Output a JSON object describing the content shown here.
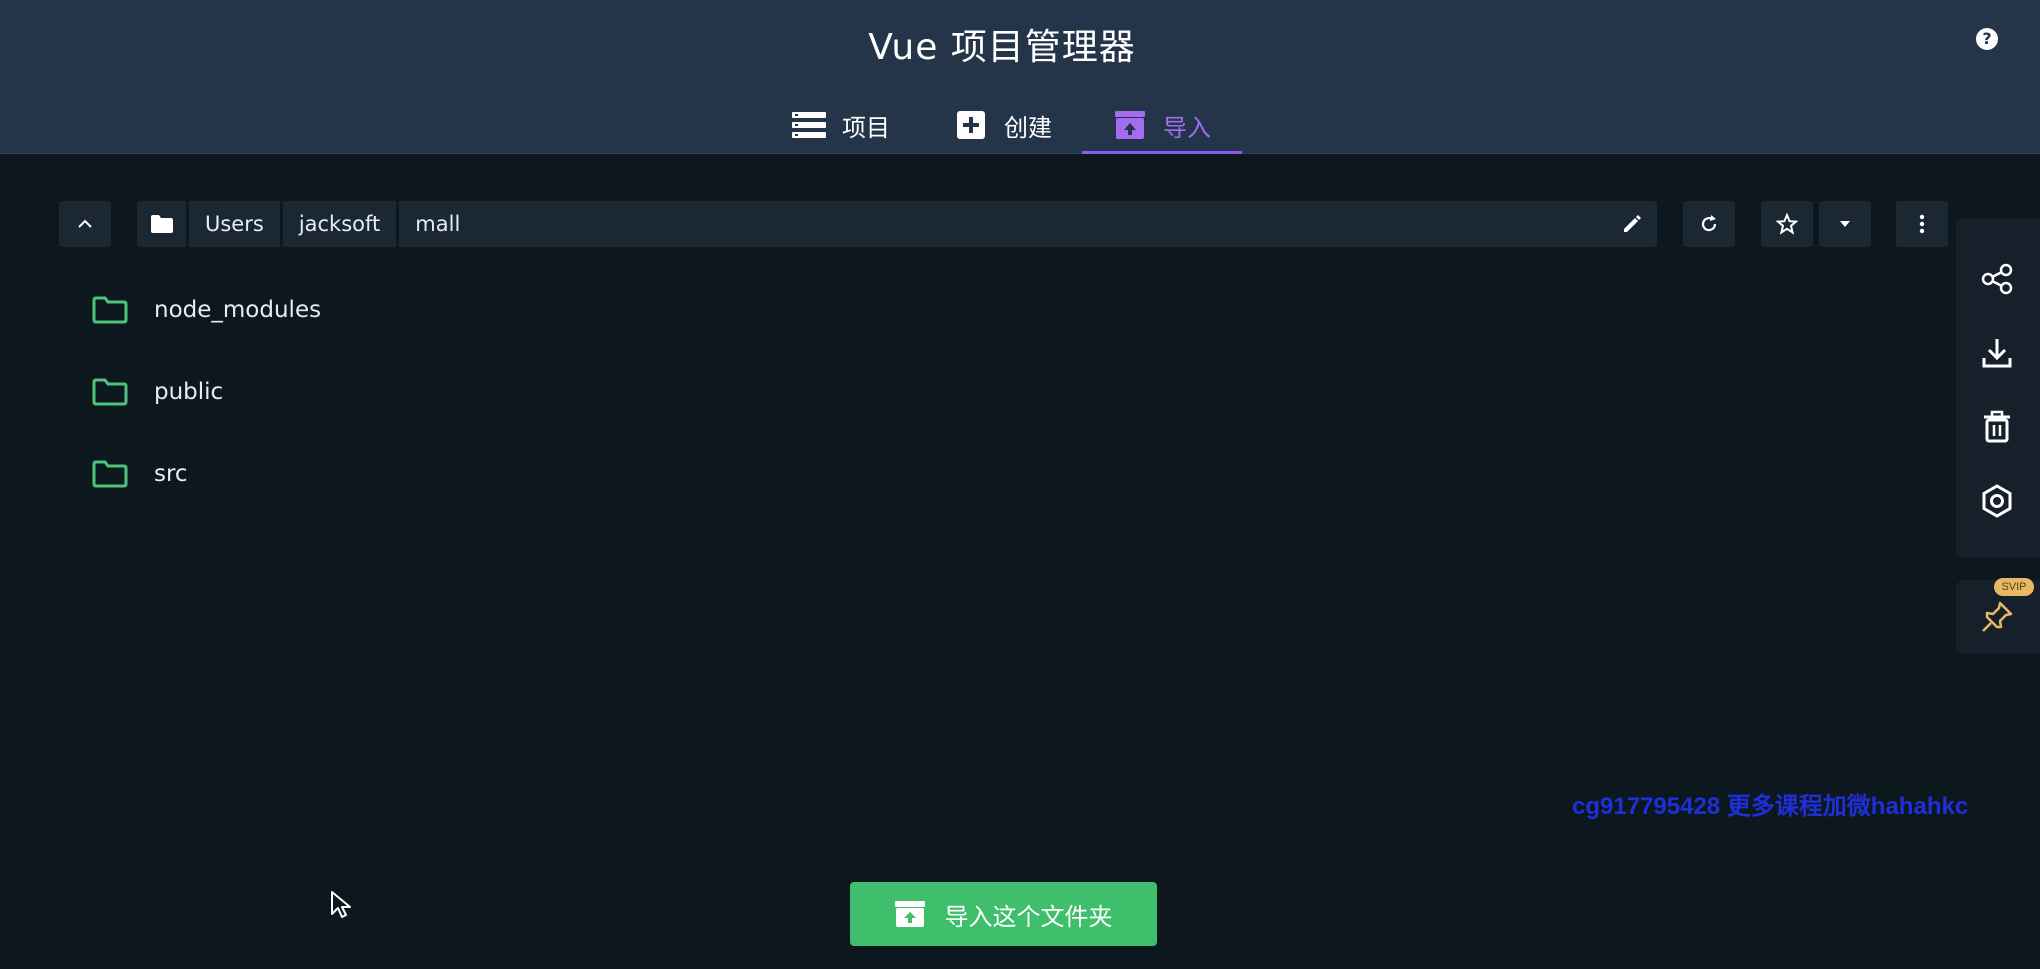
{
  "header": {
    "title": "Vue 项目管理器",
    "help_icon": "help-icon",
    "help_glyph": "?"
  },
  "tabs": [
    {
      "label": "项目",
      "icon": "list-icon"
    },
    {
      "label": "创建",
      "icon": "plus-square-icon"
    },
    {
      "label": "导入",
      "icon": "import-box-icon",
      "active": true
    }
  ],
  "toolbar": {
    "path_segments": [
      "Users",
      "jacksoft",
      "mall"
    ]
  },
  "folders": [
    {
      "name": "node_modules"
    },
    {
      "name": "public"
    },
    {
      "name": "src"
    }
  ],
  "side_panel": {
    "icons": [
      "share-icon",
      "download-icon",
      "trash-icon",
      "settings-icon"
    ],
    "pin_badge": "SVIP"
  },
  "watermark": "cg917795428 更多课程加微hahahkc",
  "import_button": {
    "label": "导入这个文件夹"
  },
  "colors": {
    "header_bg": "#24354a",
    "body_bg": "#0d171e",
    "accent_purple": "#8b5cf0",
    "folder_green": "#4fc27e",
    "button_green": "#3fbf6b"
  }
}
